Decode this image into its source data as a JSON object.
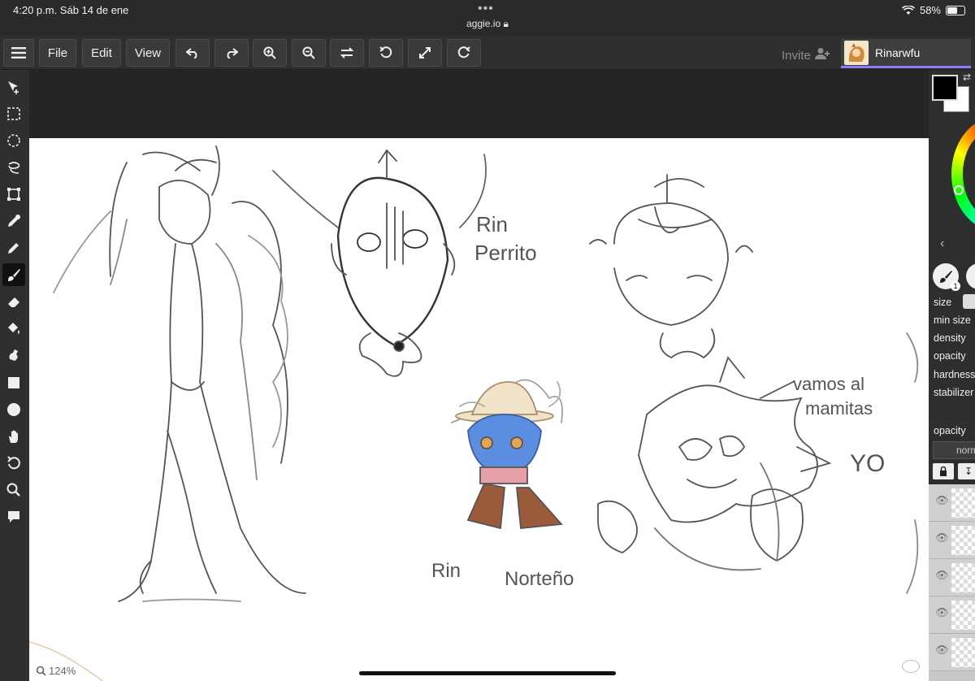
{
  "status": {
    "time": "4:20 p.m.   Sáb 14 de ene",
    "url": "aggie.io",
    "battery": "58%"
  },
  "toolbar": {
    "menu_icon": "hamburger-icon",
    "file_label": "File",
    "edit_label": "Edit",
    "view_label": "View",
    "invite_label": "Invite",
    "username": "Rinarwfu"
  },
  "tools": [
    "move-icon",
    "rect-select-icon",
    "ellipse-select-icon",
    "lasso-icon",
    "transform-icon",
    "eyedropper-icon",
    "pencil-icon",
    "brush-icon",
    "eraser-icon",
    "bucket-icon",
    "smudge-icon",
    "rectangle-icon",
    "ellipse-icon",
    "hand-icon",
    "rotate-icon",
    "zoom-icon",
    "comment-icon"
  ],
  "brush_panel": {
    "size_label": "size",
    "min_size_label": "min size",
    "density_label": "density",
    "opacity_label": "opacity",
    "hardness_label": "hardness",
    "stabilizer_label": "stabilizer",
    "brush_number": "1"
  },
  "layers_panel": {
    "opacity_label": "opacity",
    "blend_mode": "normal"
  },
  "canvas_text": {
    "rin_perrito_1": "Rin",
    "rin_perrito_2": "Perrito",
    "rin_norteno_1": "Rin",
    "rin_norteno_2": "Norteño",
    "vamos_1": "vamos al",
    "vamos_2": "mamitas",
    "yo": "YO"
  },
  "zoom": "124%",
  "colors": {
    "primary": "#000000",
    "secondary": "#ffffff",
    "accent": "#8c7dff"
  }
}
